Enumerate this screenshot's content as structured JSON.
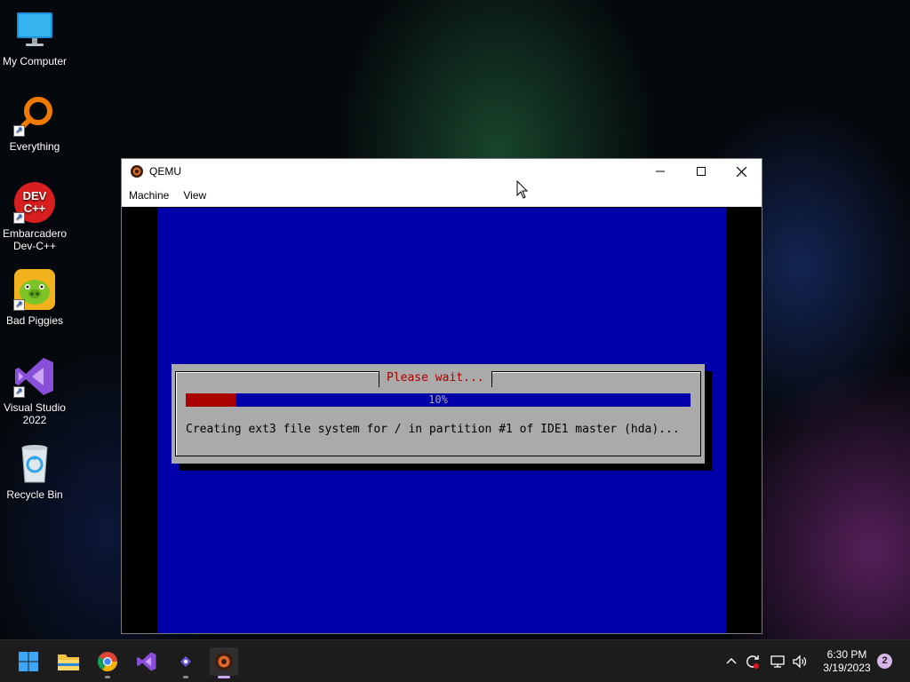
{
  "desktop": {
    "icons": [
      {
        "label": "My Computer",
        "icon": "monitor-icon"
      },
      {
        "label": "Everything",
        "icon": "magnifier-icon"
      },
      {
        "label": "Embarcadero Dev-C++",
        "art_text": "DEV C++",
        "icon": "devcpp-icon"
      },
      {
        "label": "Bad Piggies",
        "icon": "bad-piggies-icon"
      },
      {
        "label": "Visual Studio 2022",
        "icon": "visual-studio-icon"
      },
      {
        "label": "Recycle Bin",
        "icon": "recycle-bin-icon"
      }
    ]
  },
  "window": {
    "title": "QEMU",
    "menu": [
      "Machine",
      "View"
    ],
    "controls": {
      "minimize": "minimize-icon",
      "maximize": "maximize-icon",
      "close": "close-icon"
    }
  },
  "installer": {
    "dialog_title": "Please wait...",
    "progress_percent": 10,
    "progress_label": "10%",
    "message": "Creating ext3 file system for / in partition #1 of IDE1 master (hda)...",
    "colors": {
      "background": "#0000aa",
      "dialog": "#aaaaaa",
      "title": "#aa0000",
      "progress_fill": "#aa0000"
    }
  },
  "taskbar": {
    "apps": [
      "start-icon",
      "file-explorer-icon",
      "chrome-icon",
      "visual-studio-icon",
      "github-desktop-icon",
      "qemu-icon"
    ],
    "tray_icons": [
      "chevron-up-icon",
      "sync-icon",
      "network-icon",
      "volume-icon"
    ],
    "time": "6:30 PM",
    "date": "3/19/2023",
    "notification_count": "2"
  }
}
